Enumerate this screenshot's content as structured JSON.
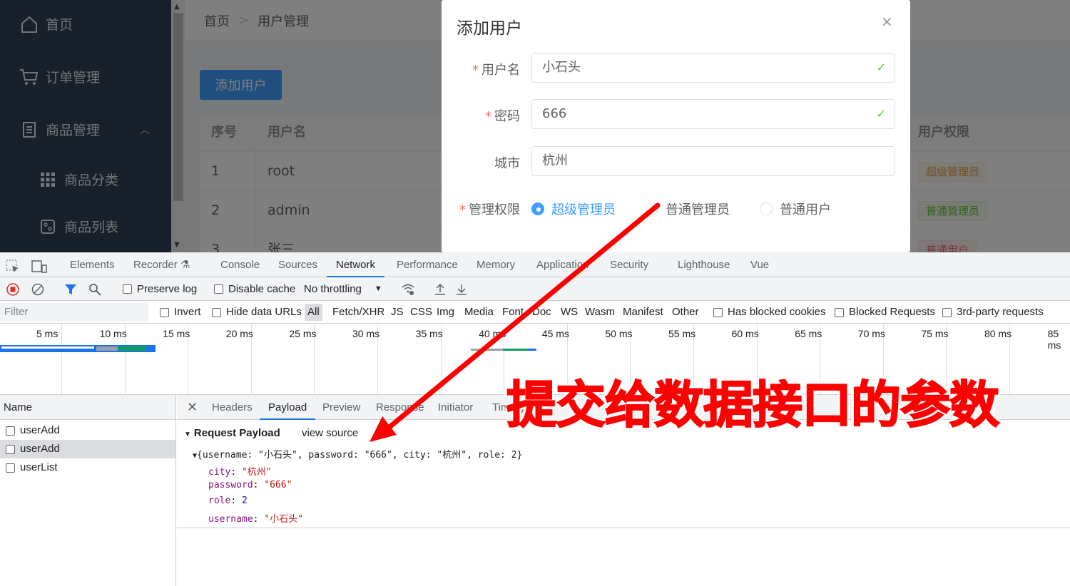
{
  "sidebar": {
    "items": [
      {
        "label": "首页",
        "icon": "home-icon"
      },
      {
        "label": "订单管理",
        "icon": "cart-icon"
      },
      {
        "label": "商品管理",
        "icon": "document-icon"
      },
      {
        "label": "商品分类",
        "icon": "grid-icon"
      },
      {
        "label": "商品列表",
        "icon": "list-icon"
      }
    ]
  },
  "breadcrumb": {
    "home": "首页",
    "separator": ">",
    "current": "用户管理"
  },
  "main": {
    "add_button": "添加用户",
    "table": {
      "headers": {
        "index": "序号",
        "username": "用户名",
        "role": "用户权限"
      },
      "rows": [
        {
          "index": "1",
          "username": "root",
          "role": "超级管理员"
        },
        {
          "index": "2",
          "username": "admin",
          "role": "普通管理员"
        },
        {
          "index": "3",
          "username": "张三",
          "role": "普通用户"
        }
      ]
    }
  },
  "dialog": {
    "title": "添加用户",
    "close": "×",
    "fields": {
      "username": {
        "label": "用户名",
        "value": "小石头",
        "required": true
      },
      "password": {
        "label": "密码",
        "value": "666",
        "required": true
      },
      "city": {
        "label": "城市",
        "value": "杭州",
        "required": false
      },
      "role": {
        "label": "管理权限",
        "required": true
      }
    },
    "role_options": [
      "超级管理员",
      "普通管理员",
      "普通用户"
    ],
    "required_mark": "*"
  },
  "devtools": {
    "tabs": [
      "Elements",
      "Recorder",
      "Console",
      "Sources",
      "Network",
      "Performance",
      "Memory",
      "Application",
      "Security",
      "Lighthouse",
      "Vue"
    ],
    "toolbar": {
      "preserve_log": "Preserve log",
      "disable_cache": "Disable cache",
      "throttling": "No throttling"
    },
    "filter": {
      "placeholder": "Filter",
      "invert": "Invert",
      "hide_data_urls": "Hide data URLs",
      "types": [
        "All",
        "Fetch/XHR",
        "JS",
        "CSS",
        "Img",
        "Media",
        "Font",
        "Doc",
        "WS",
        "Wasm",
        "Manifest",
        "Other"
      ],
      "has_blocked_cookies": "Has blocked cookies",
      "blocked_requests": "Blocked Requests",
      "third_party": "3rd-party requests"
    },
    "timeline_ticks": [
      "5 ms",
      "10 ms",
      "15 ms",
      "20 ms",
      "25 ms",
      "30 ms",
      "35 ms",
      "40 ms",
      "45 ms",
      "50 ms",
      "55 ms",
      "60 ms",
      "65 ms",
      "70 ms",
      "75 ms",
      "80 ms",
      "85 ms"
    ],
    "name_header": "Name",
    "requests": [
      "userAdd",
      "userAdd",
      "userList"
    ],
    "detail_tabs": [
      "Headers",
      "Payload",
      "Preview",
      "Response",
      "Initiator",
      "Timing"
    ],
    "payload": {
      "section_title": "Request Payload",
      "view_source": "view source",
      "summary": "{username: \"小石头\", password: \"666\", city: \"杭州\", role: 2}",
      "fields": [
        {
          "key": "city",
          "value": "\"杭州\""
        },
        {
          "key": "password",
          "value": "\"666\""
        },
        {
          "key": "role",
          "value": "2"
        },
        {
          "key": "username",
          "value": "\"小石头\""
        }
      ]
    }
  },
  "annotation": {
    "text": "提交给数据接口的参数",
    "color": "#ff0000"
  }
}
